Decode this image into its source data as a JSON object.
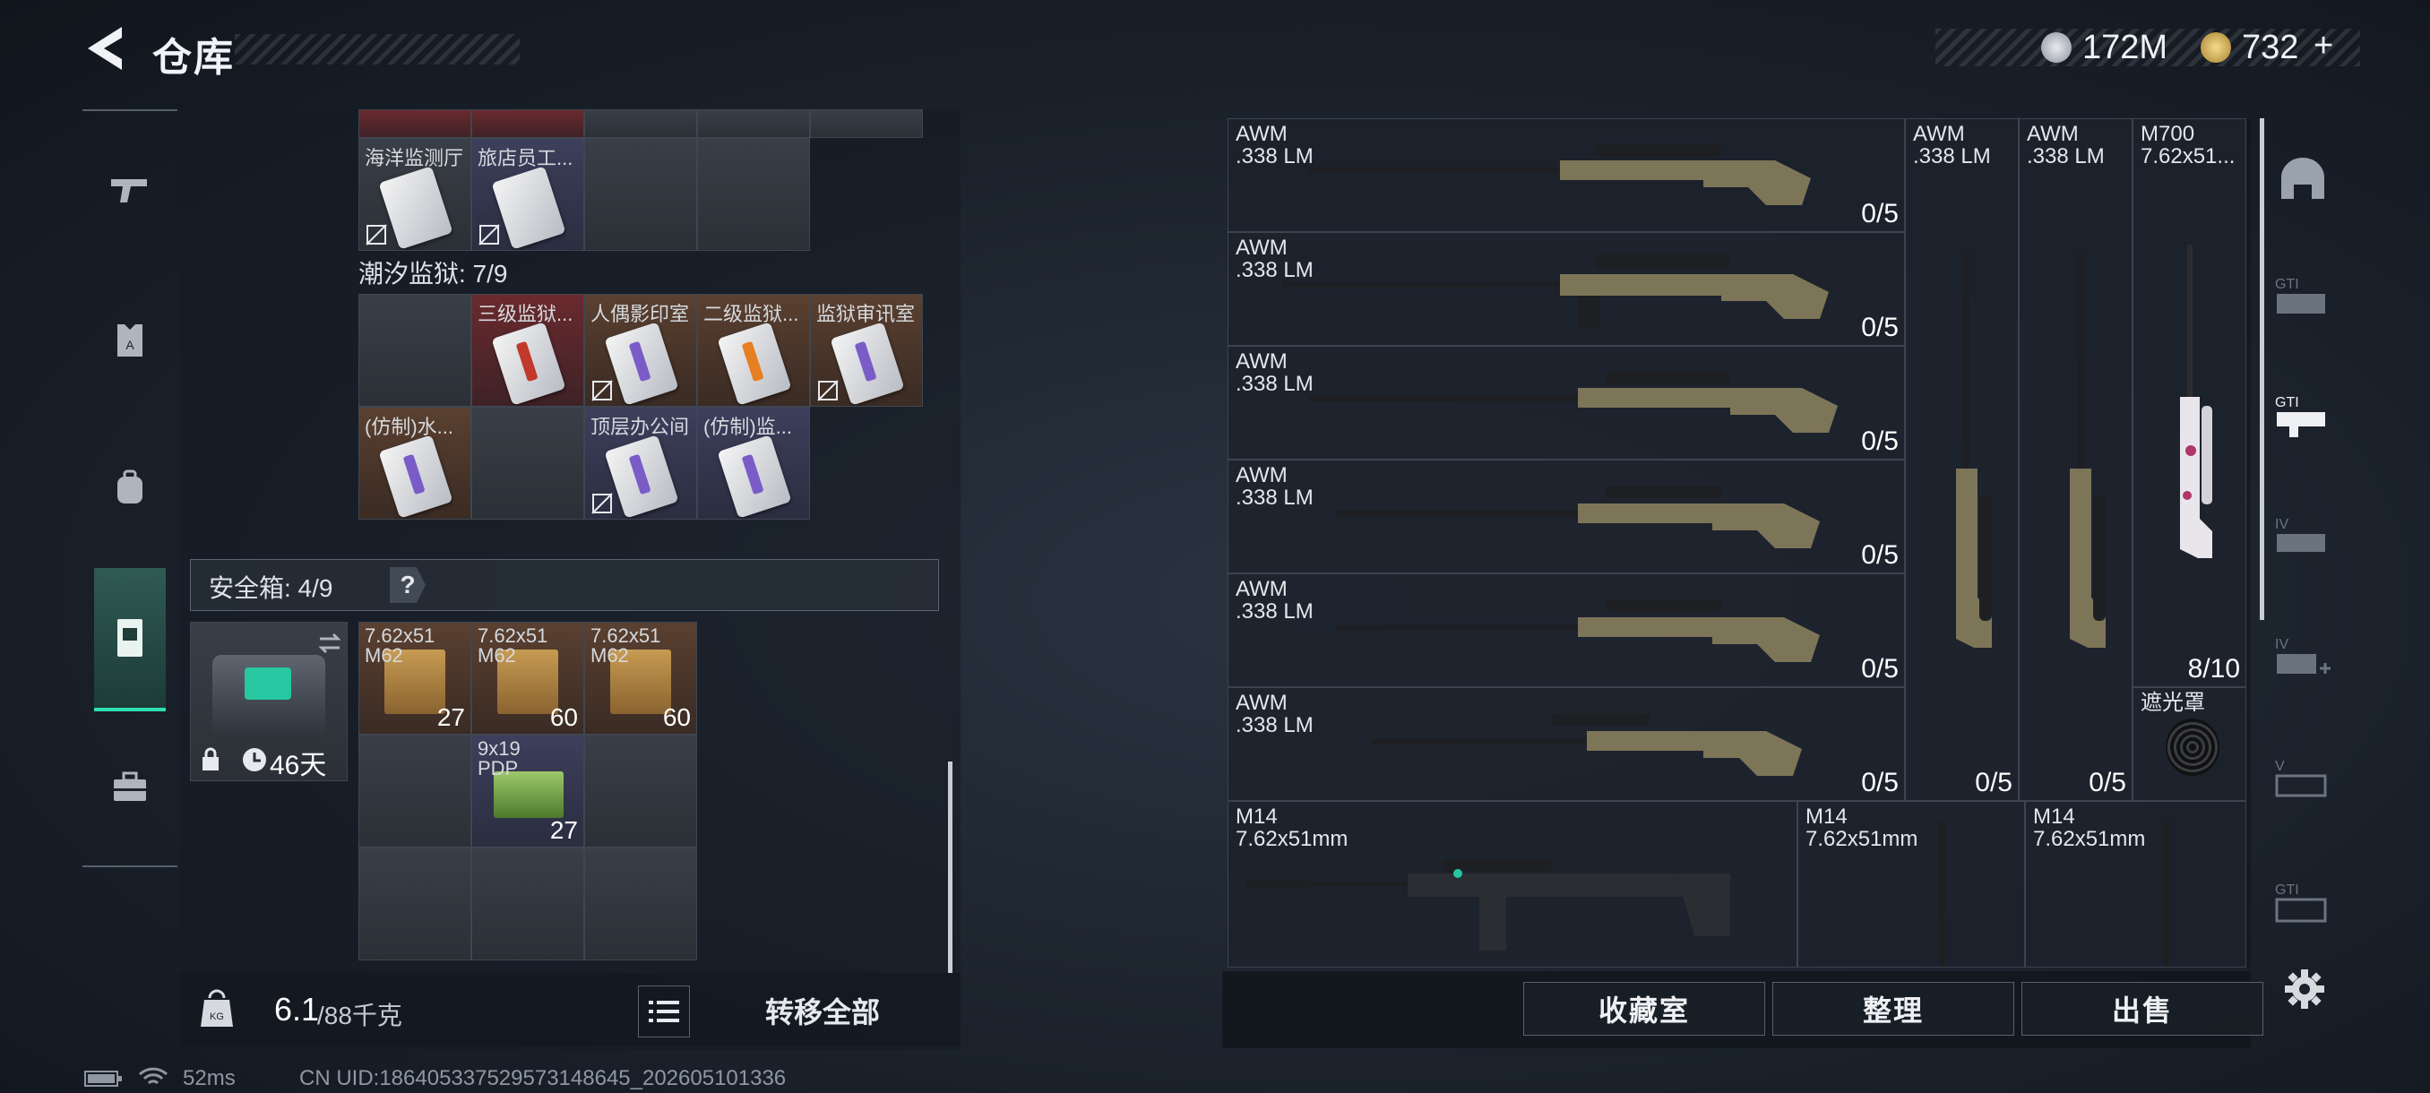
{
  "header": {
    "title": "仓库"
  },
  "currency": {
    "silver": "172M",
    "gold": "732",
    "plus": "+"
  },
  "nav": [
    "gun-icon",
    "armor-icon",
    "backpack-icon",
    "safe-box-icon",
    "toolbox-icon"
  ],
  "keys_top": [
    "海洋监测厅",
    "旅店员工..."
  ],
  "prison": {
    "label": "潮汐监狱: 7/9",
    "row1": [
      "三级监狱...",
      "人偶影印室",
      "二级监狱...",
      "监狱审讯室"
    ],
    "row2": [
      "(仿制)水...",
      "顶层办公间",
      "(仿制)监..."
    ]
  },
  "safe": {
    "label": "安全箱: 4/9",
    "help": "?",
    "days": "46天"
  },
  "safe_items": [
    {
      "name": "7.62x51\nM62",
      "qty": "27"
    },
    {
      "name": "7.62x51\nM62",
      "qty": "60"
    },
    {
      "name": "7.62x51\nM62",
      "qty": "60"
    },
    {
      "name": "9x19\nPDP",
      "qty": "27"
    }
  ],
  "weight": {
    "value": "6.1",
    "max": "/88千克"
  },
  "transfer_all": "转移全部",
  "weapons": {
    "awm_rows": [
      {
        "name": "AWM\n.338 LM",
        "count": "0/5"
      },
      {
        "name": "AWM\n.338 LM",
        "count": "0/5"
      },
      {
        "name": "AWM\n.338 LM",
        "count": "0/5"
      },
      {
        "name": "AWM\n.338 LM",
        "count": "0/5"
      },
      {
        "name": "AWM\n.338 LM",
        "count": "0/5"
      },
      {
        "name": "AWM\n.338 LM",
        "count": "0/5"
      }
    ],
    "tall": [
      {
        "name": "AWM\n.338 LM",
        "count": "0/5"
      },
      {
        "name": "AWM\n.338 LM",
        "count": "0/5"
      },
      {
        "name": "M700\n7.62x51...",
        "count": "8/10"
      }
    ],
    "muzzle": "遮光罩",
    "m14": [
      {
        "name": "M14\n7.62x51mm"
      },
      {
        "name": "M14\n7.62x51mm"
      },
      {
        "name": "M14\n7.62x51mm"
      }
    ]
  },
  "actions": {
    "collection": "收藏室",
    "sort": "整理",
    "sell": "出售"
  },
  "right_nav": [
    "helmet-icon",
    "gti-1-icon",
    "gti-2-icon",
    "iv-1-icon",
    "iv-2-icon",
    "v-icon",
    "gti-3-icon"
  ],
  "status": {
    "ping": "52ms",
    "uid": "CN UID:1864053375295731486​45_202605101336"
  },
  "colors": {
    "accent": "#2ee0b0",
    "red_cell": "#6a2a2e",
    "brown_cell": "#5a4030",
    "purple_cell": "#3d3f5c"
  }
}
